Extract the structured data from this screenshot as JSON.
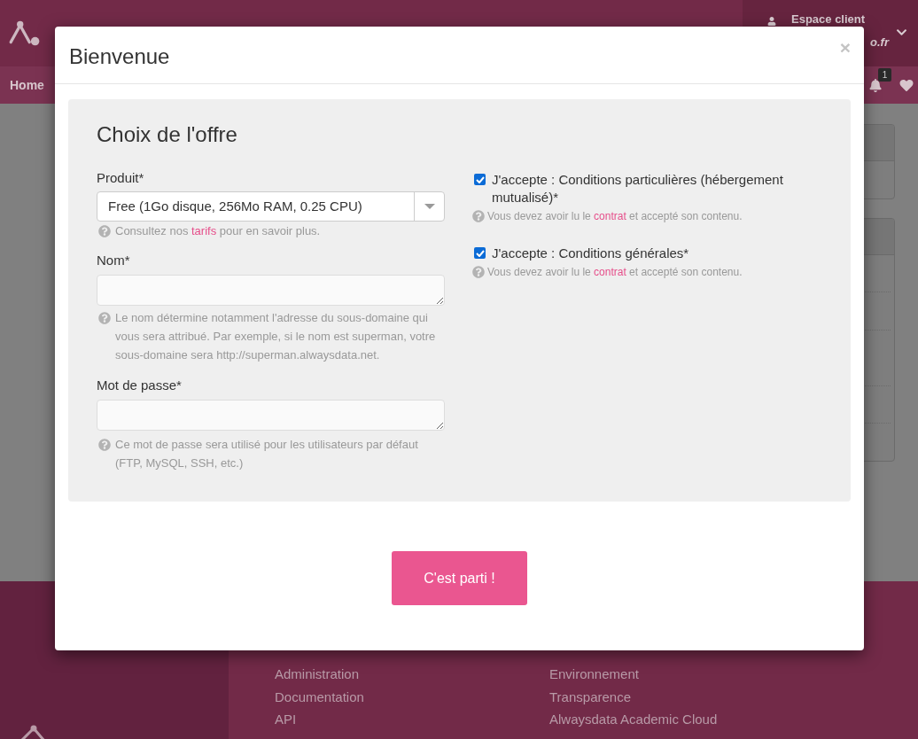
{
  "header": {
    "account_label": "Espace client",
    "account_email": "o.fr"
  },
  "nav": {
    "home": "Home",
    "notification_count": "1"
  },
  "dialog": {
    "title": "Bienvenue",
    "close": "×",
    "section_title": "Choix de l'offre",
    "fields": [
      {
        "kind": "select",
        "label": "Produit*",
        "value": "Free (1Go disque, 256Mo RAM, 0.25 CPU)",
        "help": {
          "text": "Consultez nos ",
          "link": "tarifs",
          "after": " pour en savoir plus."
        }
      },
      {
        "kind": "textarea",
        "label": "Nom*",
        "help": {
          "text": "Le nom détermine notamment l'adresse du sous-domaine qui vous sera attribué. Par exemple, si le nom est superman, votre sous-domaine sera http://superman.alwaysdata.net."
        }
      },
      {
        "kind": "textarea",
        "label": "Mot de passe*",
        "help": {
          "text": "Ce mot de passe sera utilisé pour les utilisateurs par défaut (FTP, MySQL, SSH, etc.)"
        }
      }
    ],
    "agreements": [
      {
        "label": "J'accepte : Conditions particulières (hébergement mutualisé)*",
        "checked": true,
        "help": {
          "text": "Vous devez avoir lu le ",
          "link": "contrat",
          "after": " et accepté son contenu."
        }
      },
      {
        "label": "J'accepte : Conditions générales*",
        "checked": true,
        "help": {
          "text": "Vous devez avoir lu le ",
          "link": "contrat",
          "after": " et accepté son contenu."
        }
      }
    ],
    "submit": "C'est parti !"
  },
  "footer": {
    "columns": [
      {
        "links": [
          "Administration",
          "Documentation",
          "API"
        ]
      },
      {
        "links": [
          "Environnement",
          "Transparence",
          "Alwaysdata Academic Cloud"
        ]
      }
    ]
  }
}
